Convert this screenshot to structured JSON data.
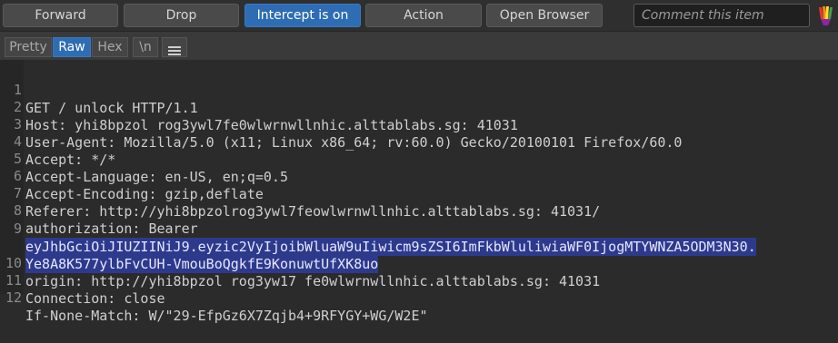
{
  "toolbar": {
    "forward": "Forward",
    "drop": "Drop",
    "intercept": "Intercept is on",
    "action": "Action",
    "open_browser": "Open Browser",
    "comment_placeholder": "Comment this item"
  },
  "tabs": {
    "pretty": "Pretty",
    "raw": "Raw",
    "hex": "Hex",
    "newline": "\\n",
    "menu_icon": "hamburger-menu-icon"
  },
  "request": {
    "line_numbers": [
      "1",
      "2",
      "3",
      "4",
      "5",
      "6",
      "7",
      "8",
      "9",
      "",
      "10",
      "11",
      "12"
    ],
    "lines": [
      "GET / unlock HTTP/1.1",
      "Host: yhi8bpzol rog3ywl7fe0wlwrnwllnhic.alttablabs.sg: 41031",
      "User-Agent: Mozilla/5.0 (x11; Linux x86_64; rv:60.0) Gecko/20100101 Firefox/60.0",
      "Accept: */*",
      "Accept-Language: en-US, en;q=0.5",
      "Accept-Encoding: gzip,deflate",
      "Referer: http://yhi8bpzolrog3ywl7feowlwrnwllnhic.alttablabs.sg: 41031/",
      "authorization: Bearer",
      "eyJhbGciOiJIUZIINiJ9.eyzic2VyIjoibWluaW9uIiwicm9sZSI6ImFkbWluliwiaWF0IjogMTYWNZA5ODM3N30.",
      "Ye8A8K577ylbFvCUH-VmouBoQgkfE9KonuwtUfXK8uo",
      "origin: http://yhi8bpzol rog3yw17 fe0wlwrnwllnhic.alttablabs.sg: 41031",
      "Connection: close",
      "If-None-Match: W/\"29-EfpGz6X7Zqjb4+9RFYGY+WG/W2E\""
    ]
  },
  "colors": {
    "accent": "#2e6db4",
    "selection": "#2d3a8c",
    "background": "#2b2b2b"
  }
}
